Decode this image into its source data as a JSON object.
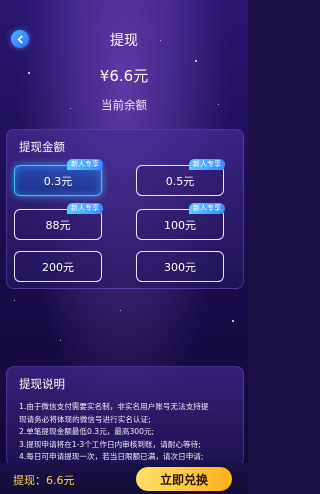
{
  "header": {
    "title": "提现"
  },
  "balance": {
    "amount": "¥6.6元",
    "label": "当前余额"
  },
  "withdraw_panel": {
    "title": "提现金额",
    "options": [
      {
        "label": "0.3元",
        "tag": "新人专享",
        "selected": true
      },
      {
        "label": "0.5元",
        "tag": "新人专享",
        "selected": false
      },
      {
        "label": "88元",
        "tag": "新人专享",
        "selected": false
      },
      {
        "label": "100元",
        "tag": "新人专享",
        "selected": false
      },
      {
        "label": "200元",
        "tag": "",
        "selected": false
      },
      {
        "label": "300元",
        "tag": "",
        "selected": false
      }
    ]
  },
  "notes_panel": {
    "title": "提现说明",
    "lines": [
      "1.由于微信支付需要实名制，非实名用户账号无法支持提",
      "现请务必将体现的微信号进行实名认证;",
      "2.单笔提现金额最低0.3元，最高300元;",
      "3.提现申请将在1-3个工作日内审核到账，请耐心等待;",
      "4.每日可申请提现一次，若当日限额已满，请次日申请;"
    ]
  },
  "footer": {
    "amount_label": "提现：6.6元",
    "button_label": "立即兑换"
  },
  "colors": {
    "accent": "#36c2ff",
    "button": "#ffc633",
    "amount": "#ffd54a"
  }
}
